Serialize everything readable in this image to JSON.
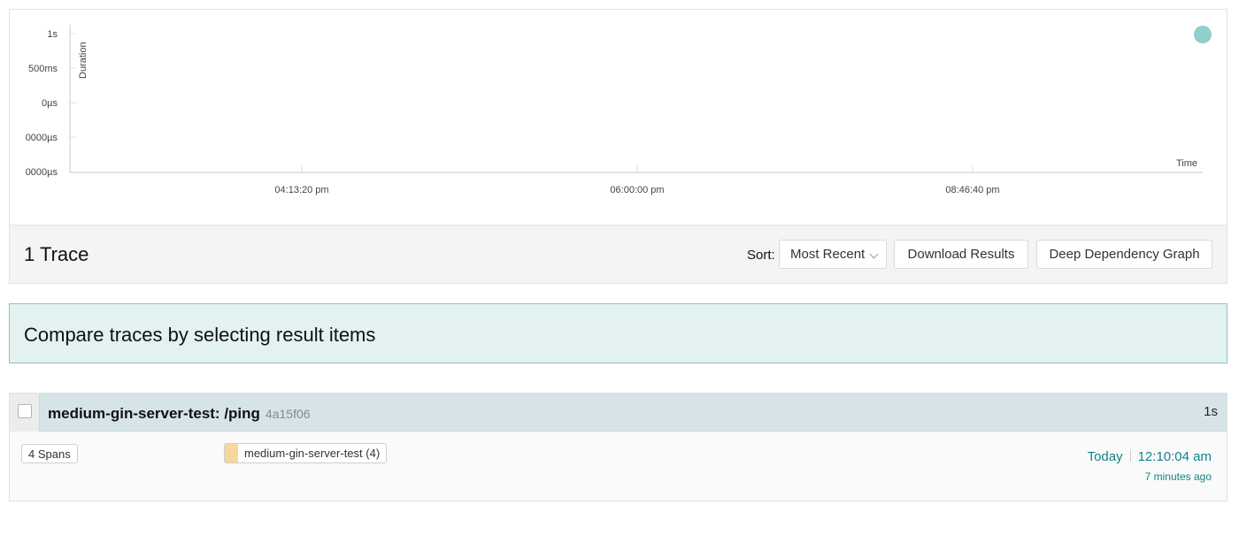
{
  "chart": {
    "y_axis_label": "Duration",
    "x_axis_label": "Time",
    "y_ticks": [
      "1s",
      "500ms",
      "0µs",
      "0000µs",
      "0000µs"
    ],
    "x_ticks": [
      "04:13:20 pm",
      "06:00:00 pm",
      "08:46:40 pm"
    ],
    "point_color": "#8fcfcd"
  },
  "results_bar": {
    "count_label": "1 Trace",
    "sort_label": "Sort:",
    "sort_value": "Most Recent",
    "download_label": "Download Results",
    "ddg_label": "Deep Dependency Graph"
  },
  "compare": {
    "message": "Compare traces by selecting result items"
  },
  "result": {
    "title": "medium-gin-server-test: /ping",
    "trace_id": "4a15f06",
    "duration": "1s",
    "spans_label": "4 Spans",
    "service_label": "medium-gin-server-test (4)",
    "service_color": "#f7d79a",
    "date": "Today",
    "time": "12:10:04 am",
    "ago": "7 minutes ago"
  }
}
